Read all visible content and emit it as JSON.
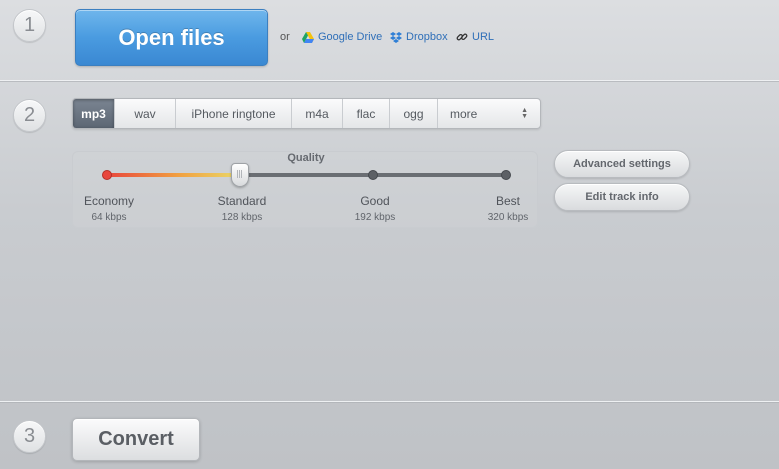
{
  "steps": {
    "one": "1",
    "two": "2",
    "three": "3"
  },
  "open": {
    "button_label": "Open files",
    "or_text": "or",
    "sources": [
      {
        "label": "Google Drive",
        "icon": "google-drive-icon"
      },
      {
        "label": "Dropbox",
        "icon": "dropbox-icon"
      },
      {
        "label": "URL",
        "icon": "link-icon"
      }
    ]
  },
  "formats": {
    "selected": "mp3",
    "items": [
      "mp3",
      "wav",
      "iPhone ringtone",
      "m4a",
      "flac",
      "ogg",
      "more"
    ]
  },
  "quality": {
    "title": "Quality",
    "selected_index": 1,
    "levels": [
      {
        "label": "Economy",
        "bitrate": "64 kbps"
      },
      {
        "label": "Standard",
        "bitrate": "128 kbps"
      },
      {
        "label": "Good",
        "bitrate": "192 kbps"
      },
      {
        "label": "Best",
        "bitrate": "320 kbps"
      }
    ]
  },
  "settings": {
    "advanced_label": "Advanced settings",
    "edit_label": "Edit track info"
  },
  "convert": {
    "button_label": "Convert"
  },
  "colors": {
    "open_button": "#4a9be0",
    "link": "#2f6fb8",
    "active_tab": "#5c6673",
    "slider_low": "#e8463c",
    "slider_high": "#e9d86a"
  }
}
